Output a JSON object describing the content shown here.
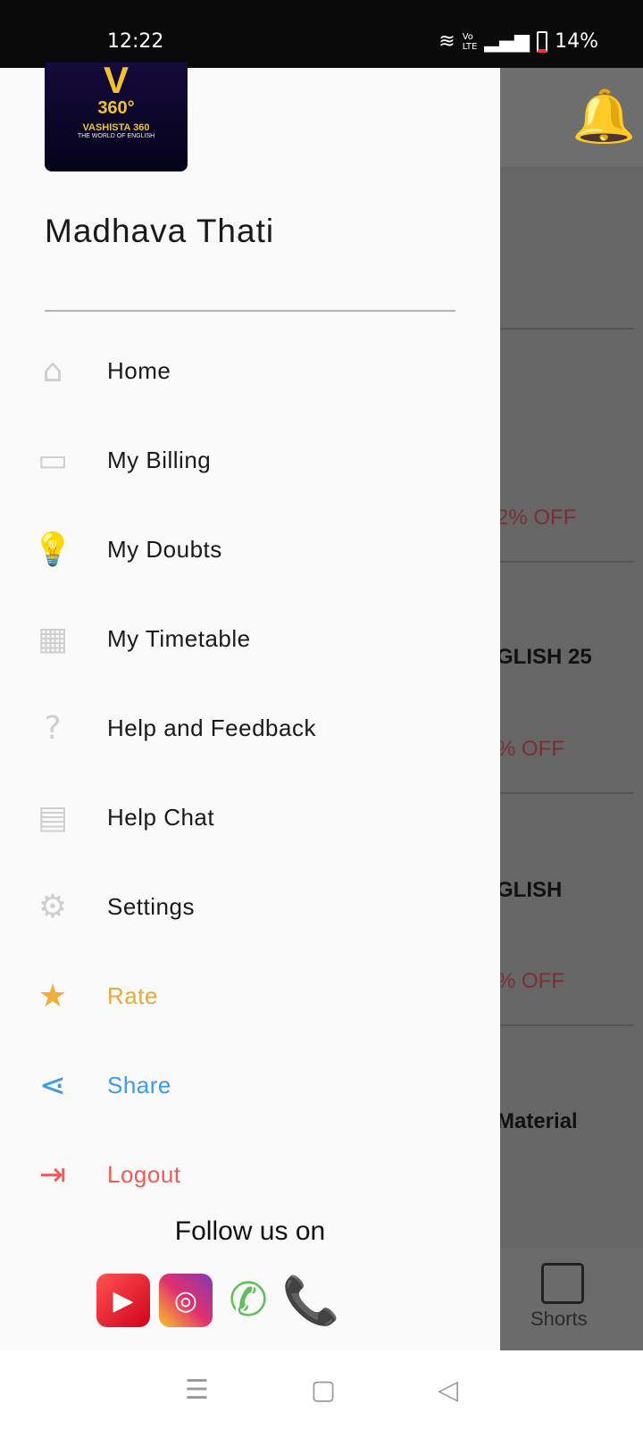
{
  "status_bar": {
    "time": "12:22",
    "battery": "14%",
    "icons": [
      "wifi-icon",
      "volte-icon",
      "signal-icon",
      "battery-icon"
    ]
  },
  "background": {
    "texts": [
      "2% OFF",
      "GLISH 25",
      "% OFF",
      "GLISH",
      "% OFF",
      "Material"
    ],
    "bottom_nav": {
      "shorts": "Shorts"
    }
  },
  "drawer": {
    "logo": {
      "top": "360°",
      "brand": "VASHISTA 360",
      "tagline": "THE WORLD OF ENGLISH"
    },
    "user_name": "Madhava Thati",
    "items": [
      {
        "label": "Home",
        "icon": "home-icon",
        "color": "#1a1a1a"
      },
      {
        "label": "My Billing",
        "icon": "billing-icon",
        "color": "#1a1a1a"
      },
      {
        "label": "My Doubts",
        "icon": "lightbulb-icon",
        "color": "#1a1a1a"
      },
      {
        "label": "My Timetable",
        "icon": "timetable-icon",
        "color": "#1a1a1a"
      },
      {
        "label": "Help and Feedback",
        "icon": "help-icon",
        "color": "#1a1a1a"
      },
      {
        "label": "Help Chat",
        "icon": "chat-icon",
        "color": "#1a1a1a"
      },
      {
        "label": "Settings",
        "icon": "gear-icon",
        "color": "#1a1a1a"
      },
      {
        "label": "Rate",
        "icon": "star-icon",
        "color": "#e8a93b"
      },
      {
        "label": "Share",
        "icon": "share-icon",
        "color": "#3d9be9"
      },
      {
        "label": "Logout",
        "icon": "logout-icon",
        "color": "#ef5a5a"
      }
    ],
    "follow_label": "Follow us on",
    "social": [
      "youtube-icon",
      "instagram-icon",
      "whatsapp-icon",
      "phone-icon"
    ]
  }
}
